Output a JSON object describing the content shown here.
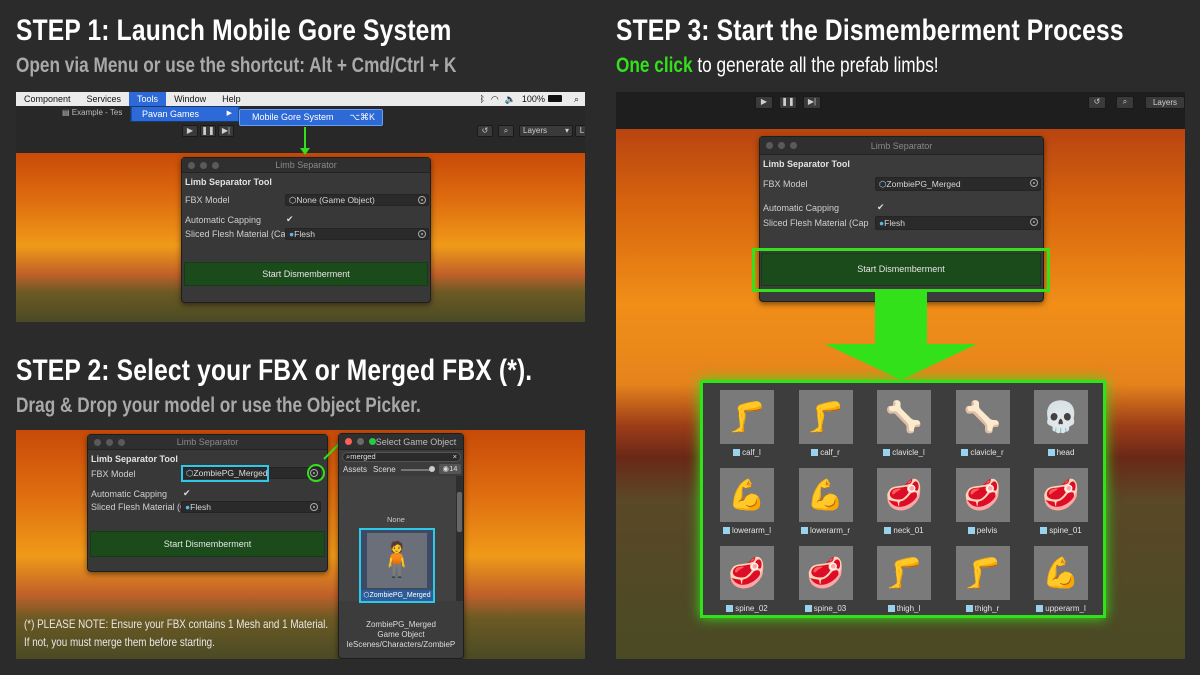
{
  "step1": {
    "title": "STEP 1: Launch Mobile Gore System",
    "subtitle": "Open via Menu or use the shortcut: Alt + Cmd/Ctrl + K",
    "menubar": [
      "Component",
      "Services",
      "Tools",
      "Window",
      "Help"
    ],
    "status": {
      "battery": "100%",
      "wifi": "wifi-icon",
      "bluetooth": "bluetooth-icon"
    },
    "tab": "Example - Tes",
    "submenu_item": "Pavan Games",
    "submenu_arrow": "▶",
    "menu_item": "Mobile Gore System",
    "shortcut": "⌥⌘K",
    "layers": "Layers",
    "layout": "L"
  },
  "step2": {
    "title": "STEP 2: Select your FBX or Merged FBX (*).",
    "subtitle": "Drag & Drop your model or use the Object Picker.",
    "picker": {
      "title": "Select Game Object",
      "search": "merged",
      "tabs": [
        "Assets",
        "Scene"
      ],
      "count": "14",
      "none": "None",
      "selected": "ZombiePG_Merged",
      "info_name": "ZombiePG_Merged",
      "info_type": "Game Object",
      "info_path": "leScenes/Characters/ZombieP"
    },
    "note_line1": "(*) PLEASE NOTE: Ensure your FBX contains 1 Mesh and 1 Material.",
    "note_line2": "If not, you must merge them before starting."
  },
  "step3": {
    "title": "STEP 3: Start the Dismemberment Process",
    "subtitle_highlight": "One click",
    "subtitle_rest": "to generate all the prefab limbs!",
    "layers": "Layers",
    "limbs": [
      {
        "name": "calf_l",
        "icon": "🦵"
      },
      {
        "name": "calf_r",
        "icon": "🦵"
      },
      {
        "name": "clavicle_l",
        "icon": "🦴"
      },
      {
        "name": "clavicle_r",
        "icon": "🦴"
      },
      {
        "name": "head",
        "icon": "💀"
      },
      {
        "name": "lowerarm_l",
        "icon": "💪"
      },
      {
        "name": "lowerarm_r",
        "icon": "💪"
      },
      {
        "name": "neck_01",
        "icon": "🥩"
      },
      {
        "name": "pelvis",
        "icon": "🥩"
      },
      {
        "name": "spine_01",
        "icon": "🥩"
      },
      {
        "name": "spine_02",
        "icon": "🥩"
      },
      {
        "name": "spine_03",
        "icon": "🥩"
      },
      {
        "name": "thigh_l",
        "icon": "🦵"
      },
      {
        "name": "thigh_r",
        "icon": "🦵"
      },
      {
        "name": "upperarm_l",
        "icon": "💪"
      }
    ]
  },
  "tool": {
    "window_title": "Limb Separator",
    "tool_title": "Limb Separator Tool",
    "fbx_label": "FBX Model",
    "fbx_none": "None (Game Object)",
    "fbx_merged": "ZombiePG_Merged",
    "capping_label": "Automatic Capping",
    "capping_check": "✔",
    "flesh_label": "Sliced Flesh Material (Cap",
    "flesh_value": "Flesh",
    "start_button": "Start Dismemberment"
  },
  "colors": {
    "green": "#33e11a",
    "cyan": "#2ec8e8",
    "background": "#2b2b2b"
  }
}
